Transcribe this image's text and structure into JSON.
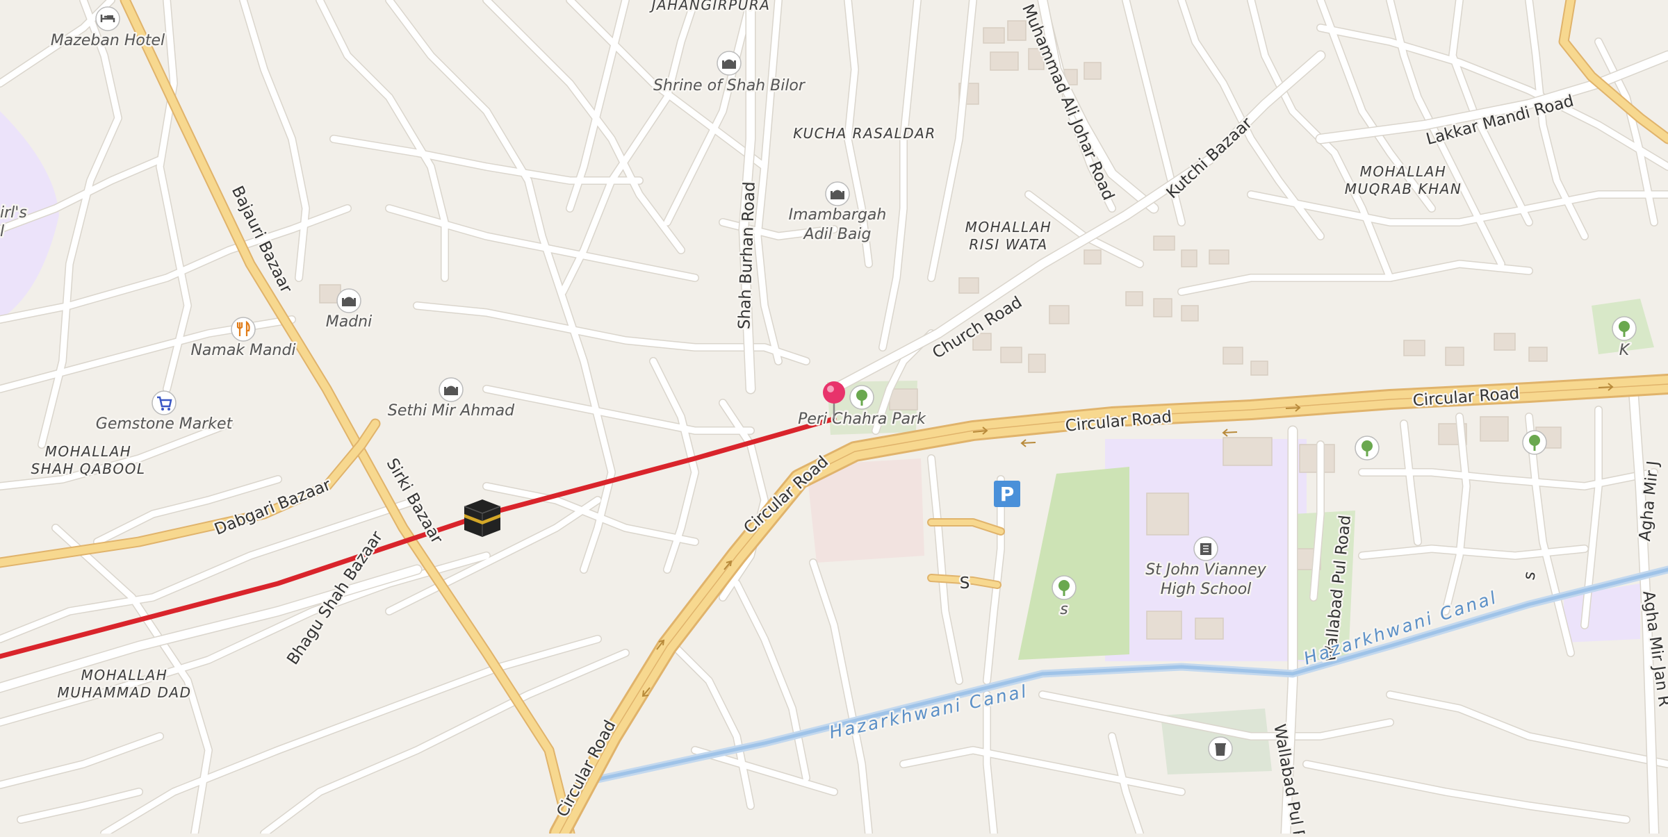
{
  "colors": {
    "background": "#f2efe9",
    "major_road": "#f7d88f",
    "major_road_casing": "#e0b36b",
    "street": "#ffffff",
    "park": "#cde3b5",
    "school": "#ece3fa",
    "water": "#a9cbee",
    "route_line": "#d9242b",
    "pin": "#e8336b",
    "parking": "#4a90d9"
  },
  "areas": [
    {
      "lines": [
        "JAHANGIRPURA"
      ]
    },
    {
      "lines": [
        "KUCHA RASALDAR"
      ]
    },
    {
      "lines": [
        "MOHALLAH",
        "MUQRAB KHAN"
      ]
    },
    {
      "lines": [
        "MOHALLAH",
        "RISI WATA"
      ]
    },
    {
      "lines": [
        "MOHALLAH",
        "SHAH QABOOL"
      ]
    },
    {
      "lines": [
        "MOHALLAH",
        "MUHAMMAD DAD"
      ]
    }
  ],
  "pois": [
    {
      "name": "Mazeban Hotel",
      "icon": "bed-icon"
    },
    {
      "name": "Shrine of Shah Bilor",
      "icon": "shrine-icon"
    },
    {
      "name": "Imambargah",
      "name2": "Adil Baig",
      "icon": "shrine-icon"
    },
    {
      "name": "Madni",
      "icon": "mosque-icon"
    },
    {
      "name": "Namak Mandi",
      "icon": "restaurant-icon"
    },
    {
      "name": "Gemstone Market",
      "icon": "shopping-cart-icon"
    },
    {
      "name": "Sethi Mir Ahmad",
      "icon": "shrine-icon"
    },
    {
      "name": "Peri Chahra Park",
      "icon": "tree-icon"
    },
    {
      "name": "St John Vianney",
      "name2": "High School",
      "icon": "school-icon"
    },
    {
      "name": "s",
      "icon": "tree-icon"
    },
    {
      "name": "K",
      "icon": "tree-icon"
    },
    {
      "name": "irl's",
      "name2": "l",
      "icon": ""
    }
  ],
  "roads": [
    "Bajauri Bazaar",
    "Sirki Bazaar",
    "Dabgari Bazaar",
    "Bhagu Shah Bazaar",
    "Shah Burhan Road",
    "Muhammad Ali Johar Road",
    "Kutchi Bazaar",
    "Lakkar Mandi Road",
    "Church Road",
    "Circular Road",
    "Circular Road",
    "Circular Road",
    "Circular Road",
    "Wallabad Pul Road",
    "Wallabad Pul R",
    "Agha Mir J",
    "Agha Mir Jan R",
    "s",
    "S"
  ],
  "canal": [
    "Hazarkhwani Canal",
    "Hazarkhwani Canal"
  ],
  "markers": {
    "pin": "location-pin-icon",
    "kaaba": "kaaba-icon",
    "parking": "P"
  }
}
